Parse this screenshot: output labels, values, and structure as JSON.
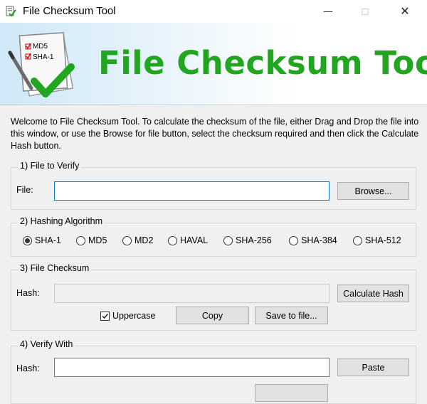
{
  "window": {
    "title": "File Checksum Tool",
    "minimize_glyph": "—",
    "maximize_glyph": "☐",
    "close_glyph": "✕"
  },
  "banner": {
    "title": "File Checksum Tool",
    "art_items": [
      "MD5",
      "SHA-1"
    ],
    "title_color": "#22a51f"
  },
  "intro": "Welcome to File Checksum Tool. To calculate the checksum of the file, either Drag and Drop the file into this window, or use the Browse for file button, select the checksum required and then click the Calculate Hash button.",
  "file_group": {
    "legend": "1) File to Verify",
    "file_label": "File:",
    "file_value": "",
    "browse_label": "Browse..."
  },
  "hash_group": {
    "legend": "2) Hashing Algorithm",
    "algorithms": [
      "SHA-1",
      "MD5",
      "MD2",
      "HAVAL",
      "SHA-256",
      "SHA-384",
      "SHA-512"
    ],
    "selected": "SHA-1"
  },
  "checksum_group": {
    "legend": "3) File Checksum",
    "hash_label": "Hash:",
    "hash_value": "",
    "calculate_label": "Calculate Hash",
    "uppercase_label": "Uppercase",
    "uppercase_checked": true,
    "copy_label": "Copy",
    "save_label": "Save to file..."
  },
  "verify_group": {
    "legend": "4) Verify With",
    "hash_label": "Hash:",
    "hash_value": "",
    "paste_label": "Paste"
  }
}
